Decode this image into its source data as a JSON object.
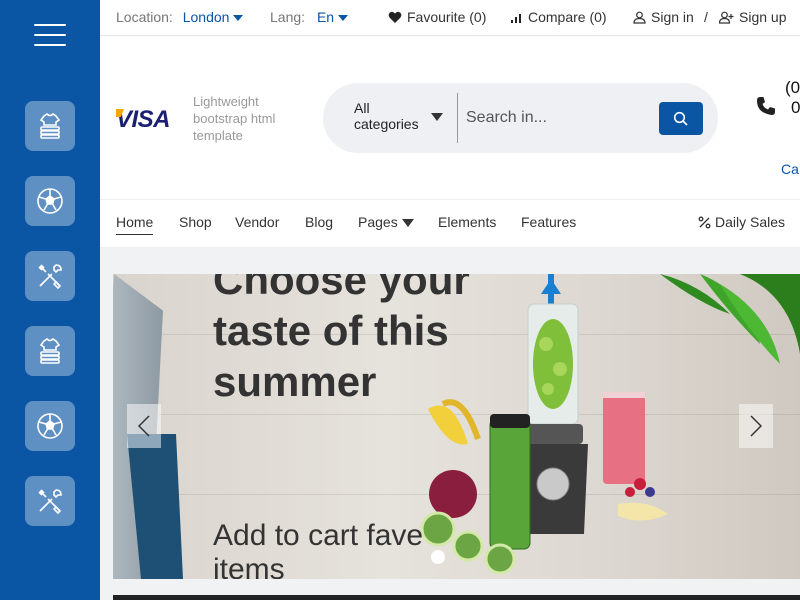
{
  "topbar": {
    "location_label": "Location:",
    "location_value": "London",
    "lang_label": "Lang:",
    "lang_value": "En",
    "favourite": "Favourite (0)",
    "compare": "Compare (0)",
    "signin": "Sign in",
    "separator": "/",
    "signup": "Sign up"
  },
  "sidebar": {
    "items": [
      {
        "icon": "shirt-stack-icon"
      },
      {
        "icon": "football-icon"
      },
      {
        "icon": "tools-icon"
      },
      {
        "icon": "shirt-stack-icon"
      },
      {
        "icon": "football-icon"
      },
      {
        "icon": "tools-icon"
      }
    ]
  },
  "header": {
    "logo": "VISA",
    "tagline": "Lightweight bootstrap html template",
    "search": {
      "category_line1": "All",
      "category_line2": "categories",
      "placeholder": "Search in..."
    },
    "phone_line1": "(0",
    "phone_line2": "0",
    "cart_fragment": "Ca"
  },
  "nav": {
    "items": [
      "Home",
      "Shop",
      "Vendor",
      "Blog",
      "Pages",
      "Elements",
      "Features"
    ],
    "daily_sales": "Daily Sales"
  },
  "banner": {
    "title": "Choose your taste of this summer",
    "subtitle": "Add to cart fave items"
  },
  "colors": {
    "primary": "#0a55a4",
    "sidebar_tile": "rgba(255,255,255,0.35)",
    "text_dark": "#333333",
    "band_bg": "#f1f2f4"
  }
}
